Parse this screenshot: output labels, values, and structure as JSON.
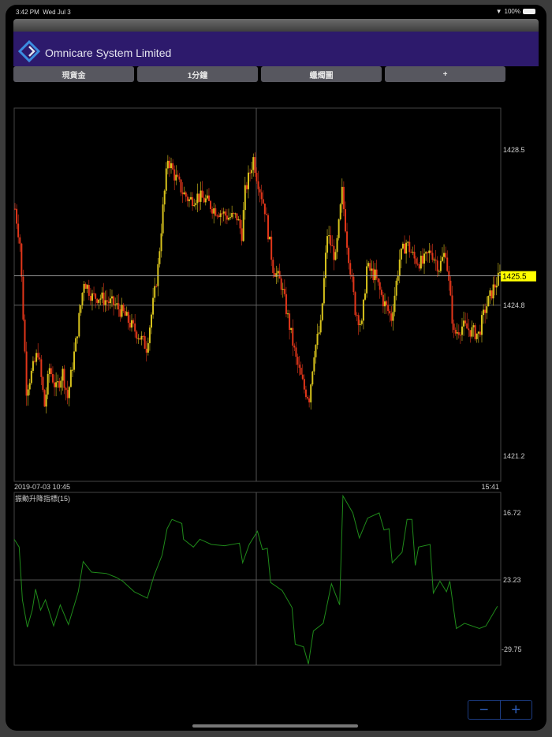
{
  "status_bar": {
    "time": "3:42 PM",
    "date": "Wed Jul 3",
    "battery": "100%"
  },
  "header": {
    "title": "Omnicare System Limited"
  },
  "tabs": [
    {
      "label": "現貨金"
    },
    {
      "label": "1分鐘"
    },
    {
      "label": "蠟燭圖"
    },
    {
      "label": "+"
    }
  ],
  "zoom": {
    "minus": "−",
    "plus": "+"
  },
  "colors": {
    "up": "#d8c31c",
    "down": "#e2361a",
    "indicator": "#1f8a1a",
    "header": "#2d1a6c",
    "price_tag": "#ffff00"
  },
  "chart_data": [
    {
      "type": "candlestick",
      "title": "",
      "x_start_label": "2019-07-03 10:45",
      "x_end_label": "15:41",
      "minutes": 296,
      "ylim": [
        1420.6,
        1429.5
      ],
      "y_ticks": [
        "1428.5",
        "1424.8",
        "1421.2"
      ],
      "y_tick_values": [
        1428.5,
        1424.8,
        1421.2
      ],
      "current_price": "1425.5",
      "current_value": 1425.5,
      "crosshair_minute": 147,
      "close_path": [
        [
          0,
          1427.1
        ],
        [
          3,
          1426.3
        ],
        [
          7,
          1422.8
        ],
        [
          11,
          1423.3
        ],
        [
          14,
          1423.7
        ],
        [
          18,
          1422.4
        ],
        [
          21,
          1423.3
        ],
        [
          25,
          1422.8
        ],
        [
          29,
          1423.2
        ],
        [
          32,
          1422.6
        ],
        [
          37,
          1423.9
        ],
        [
          42,
          1425.4
        ],
        [
          47,
          1425.0
        ],
        [
          51,
          1425.0
        ],
        [
          56,
          1424.9
        ],
        [
          61,
          1424.8
        ],
        [
          66,
          1424.6
        ],
        [
          71,
          1424.3
        ],
        [
          75,
          1424.1
        ],
        [
          80,
          1423.8
        ],
        [
          85,
          1425.1
        ],
        [
          87,
          1425.7
        ],
        [
          90,
          1427.1
        ],
        [
          93,
          1428.3
        ],
        [
          97,
          1427.9
        ],
        [
          102,
          1427.5
        ],
        [
          106,
          1427.3
        ],
        [
          111,
          1427.4
        ],
        [
          116,
          1427.3
        ],
        [
          121,
          1427.1
        ],
        [
          126,
          1427.0
        ],
        [
          130,
          1426.9
        ],
        [
          135,
          1426.9
        ],
        [
          138,
          1426.5
        ],
        [
          140,
          1427.5
        ],
        [
          145,
          1428.3
        ],
        [
          147,
          1427.9
        ],
        [
          152,
          1427.1
        ],
        [
          157,
          1425.7
        ],
        [
          162,
          1425.3
        ],
        [
          166,
          1424.5
        ],
        [
          171,
          1423.5
        ],
        [
          176,
          1422.8
        ],
        [
          179,
          1422.6
        ],
        [
          182,
          1423.7
        ],
        [
          186,
          1424.3
        ],
        [
          190,
          1426.5
        ],
        [
          195,
          1425.9
        ],
        [
          199,
          1427.5
        ],
        [
          202,
          1426.3
        ],
        [
          207,
          1424.7
        ],
        [
          211,
          1424.3
        ],
        [
          214,
          1425.7
        ],
        [
          219,
          1425.5
        ],
        [
          224,
          1424.9
        ],
        [
          229,
          1424.5
        ],
        [
          234,
          1425.9
        ],
        [
          238,
          1426.3
        ],
        [
          243,
          1425.9
        ],
        [
          248,
          1425.8
        ],
        [
          253,
          1426.1
        ],
        [
          258,
          1425.7
        ],
        [
          262,
          1426.1
        ],
        [
          267,
          1424.1
        ],
        [
          272,
          1424.3
        ],
        [
          277,
          1424.2
        ],
        [
          282,
          1424.1
        ],
        [
          286,
          1424.7
        ],
        [
          291,
          1425.2
        ],
        [
          295,
          1425.5
        ]
      ]
    },
    {
      "type": "line",
      "title": "振動升降指標(15)",
      "ylim": [
        -40,
        40
      ],
      "y_ticks": [
        "16.72",
        "23.23",
        "-29.75"
      ],
      "path": [
        [
          0,
          18.3
        ],
        [
          3,
          14.7
        ],
        [
          5,
          -9.7
        ],
        [
          8,
          -22.4
        ],
        [
          11,
          -14.5
        ],
        [
          13,
          -4.8
        ],
        [
          16,
          -14.5
        ],
        [
          19,
          -9.7
        ],
        [
          24,
          -21.8
        ],
        [
          28,
          -12.1
        ],
        [
          33,
          -21.2
        ],
        [
          39,
          -6.0
        ],
        [
          42,
          8.0
        ],
        [
          47,
          3.1
        ],
        [
          56,
          2.5
        ],
        [
          62,
          0.7
        ],
        [
          66,
          -1.1
        ],
        [
          73,
          -6.0
        ],
        [
          81,
          -9.0
        ],
        [
          85,
          1.3
        ],
        [
          90,
          11.0
        ],
        [
          93,
          23.2
        ],
        [
          96,
          27.5
        ],
        [
          102,
          25.6
        ],
        [
          103,
          18.3
        ],
        [
          109,
          14.7
        ],
        [
          113,
          18.3
        ],
        [
          120,
          15.9
        ],
        [
          128,
          15.3
        ],
        [
          137,
          16.5
        ],
        [
          139,
          7.4
        ],
        [
          143,
          15.9
        ],
        [
          148,
          22.0
        ],
        [
          151,
          13.5
        ],
        [
          154,
          14.1
        ],
        [
          156,
          -1.7
        ],
        [
          163,
          -5.4
        ],
        [
          169,
          -13.3
        ],
        [
          171,
          -30.3
        ],
        [
          176,
          -31.5
        ],
        [
          179,
          -39.5
        ],
        [
          182,
          -24.2
        ],
        [
          188,
          -20.6
        ],
        [
          193,
          -2.3
        ],
        [
          198,
          -12.1
        ],
        [
          200,
          38.4
        ],
        [
          206,
          30.5
        ],
        [
          210,
          18.9
        ],
        [
          215,
          28.1
        ],
        [
          222,
          30.5
        ],
        [
          225,
          22.6
        ],
        [
          228,
          23.2
        ],
        [
          230,
          7.4
        ],
        [
          236,
          12.3
        ],
        [
          239,
          27.5
        ],
        [
          242,
          27.5
        ],
        [
          244,
          6.2
        ],
        [
          246,
          14.7
        ],
        [
          253,
          15.9
        ],
        [
          255,
          -6.6
        ],
        [
          259,
          -1.1
        ],
        [
          263,
          -6.0
        ],
        [
          265,
          -1.1
        ],
        [
          269,
          -23.0
        ],
        [
          274,
          -20.6
        ],
        [
          283,
          -23.0
        ],
        [
          287,
          -21.8
        ],
        [
          294,
          -12.7
        ]
      ]
    }
  ]
}
